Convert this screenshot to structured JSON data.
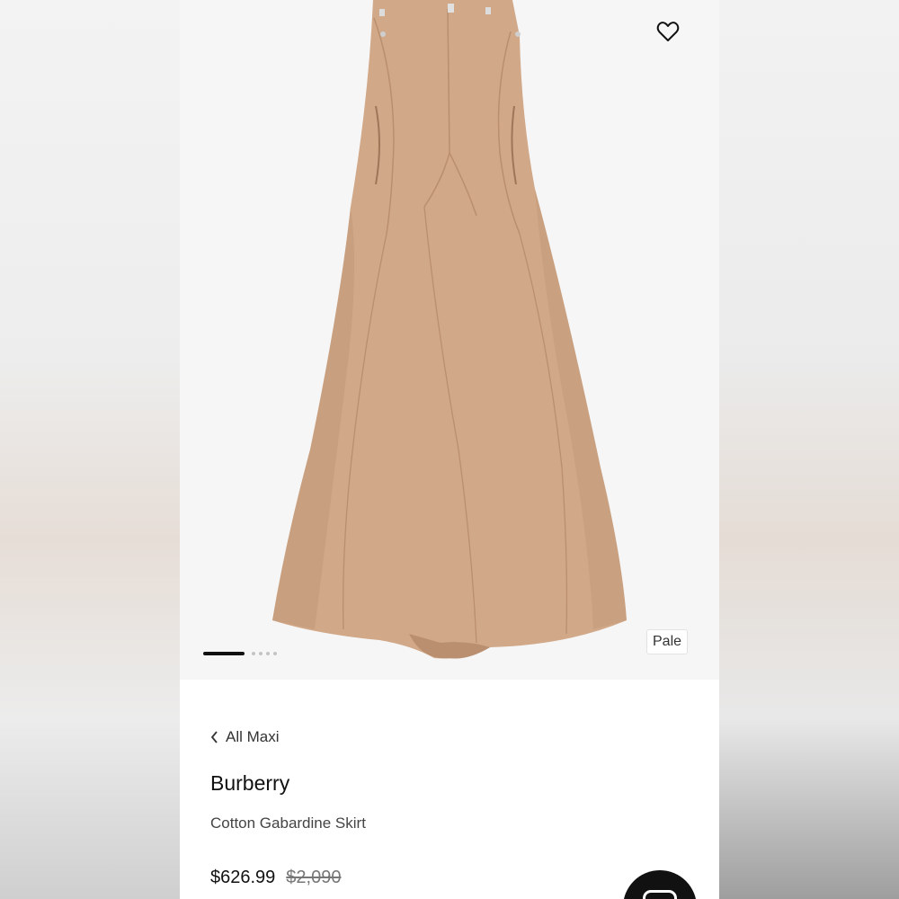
{
  "colors": {
    "skirt": "#d1a888",
    "skirt_shadow": "#b98f70",
    "accent": "#111111",
    "background": "#f6f6f6"
  },
  "gallery": {
    "image_subject": "tan cotton gabardine maxi skirt",
    "active_slide": 1,
    "total_slides": 5,
    "color_badge": "Pale",
    "wishlist_icon": "heart-outline-icon"
  },
  "breadcrumb": {
    "back_icon": "chevron-left-icon",
    "label": "All Maxi"
  },
  "product": {
    "brand": "Burberry",
    "name": "Cotton Gabardine Skirt",
    "price": "$626.99",
    "original_price": "$2,090"
  },
  "fab": {
    "icon": "chat-bubble-icon"
  }
}
